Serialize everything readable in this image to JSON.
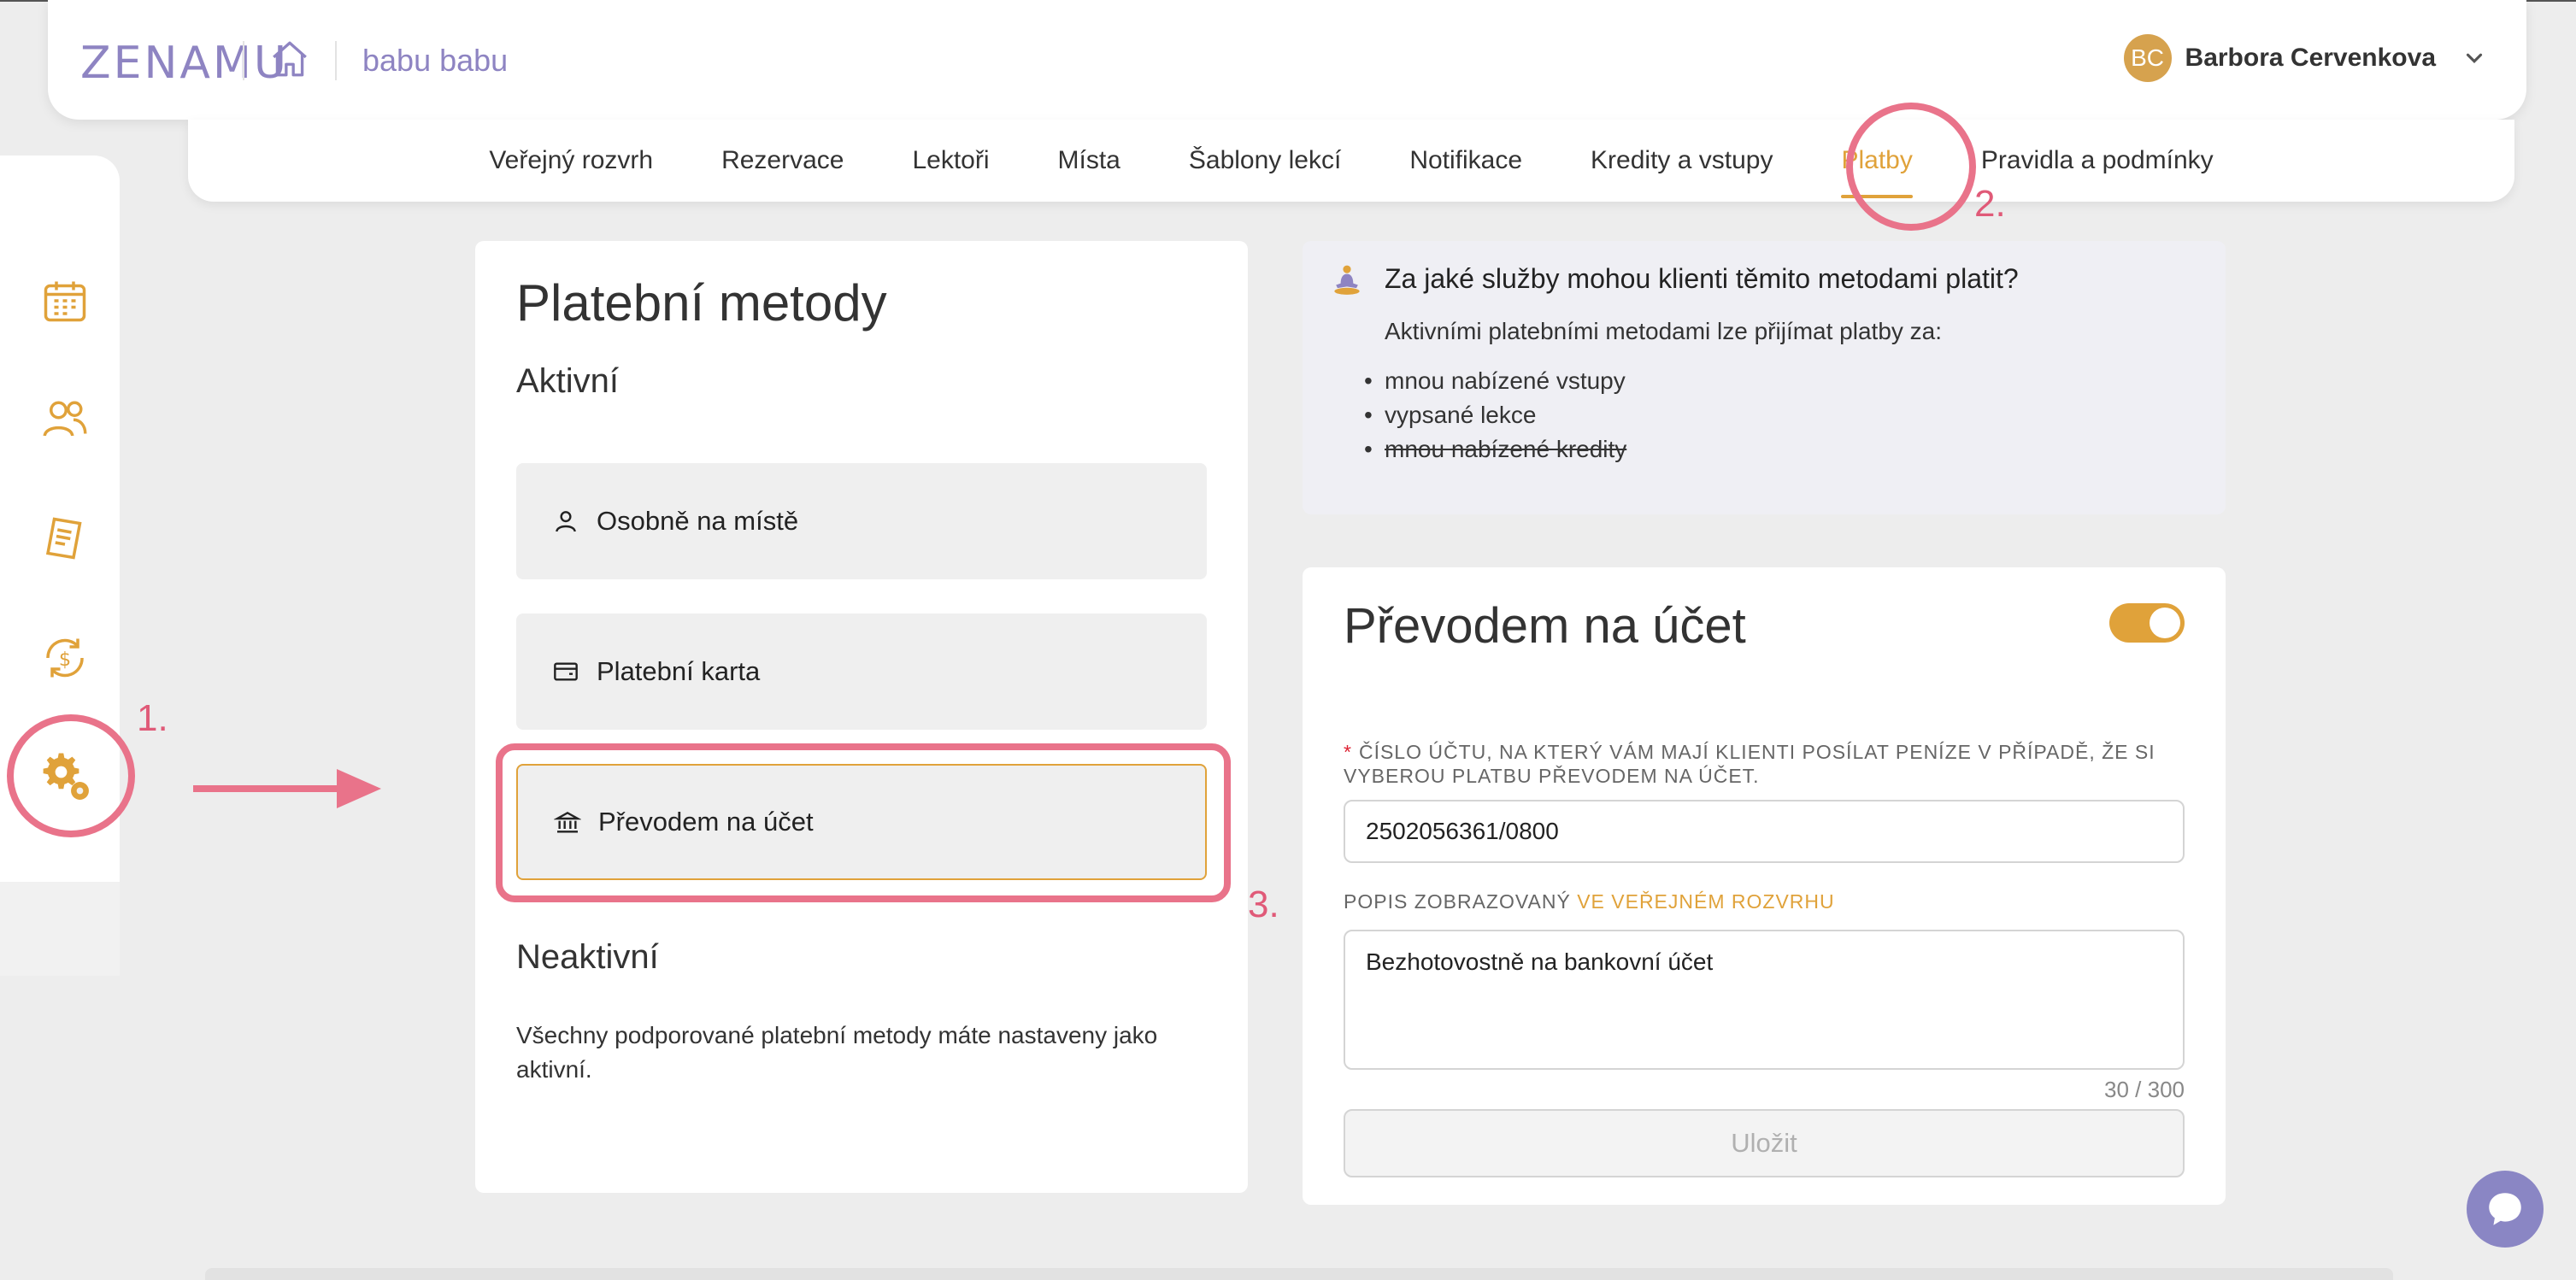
{
  "header": {
    "logo": "ZENAMU",
    "studio_name": "babu babu",
    "user_initials": "BC",
    "user_name": "Barbora Cervenkova"
  },
  "nav": {
    "tabs": [
      {
        "label": "Veřejný rozvrh"
      },
      {
        "label": "Rezervace"
      },
      {
        "label": "Lektoři"
      },
      {
        "label": "Místa"
      },
      {
        "label": "Šablony lekcí"
      },
      {
        "label": "Notifikace"
      },
      {
        "label": "Kredity a vstupy"
      },
      {
        "label": "Platby",
        "active": true
      },
      {
        "label": "Pravidla a podmínky"
      }
    ]
  },
  "sidebar": {
    "icons": [
      "calendar-icon",
      "people-icon",
      "receipt-icon",
      "payments-icon",
      "settings-icon"
    ]
  },
  "payment_methods": {
    "title": "Platební metody",
    "active_heading": "Aktivní",
    "active": [
      {
        "label": "Osobně na místě",
        "icon": "person-icon"
      },
      {
        "label": "Platební karta",
        "icon": "card-icon"
      },
      {
        "label": "Převodem na účet",
        "icon": "bank-icon",
        "selected": true
      }
    ],
    "inactive_heading": "Neaktivní",
    "inactive_note": "Všechny podporované platební metody máte nastaveny jako aktivní."
  },
  "info": {
    "title": "Za jaké služby mohou klienti těmito metodami platit?",
    "subtitle": "Aktivními platebními metodami lze přijímat platby za:",
    "items": [
      {
        "text": "mnou nabízené vstupy",
        "struck": false
      },
      {
        "text": "vypsané lekce",
        "struck": false
      },
      {
        "text": "mnou nabízené kredity",
        "struck": true
      }
    ]
  },
  "transfer_form": {
    "title": "Převodem na účet",
    "enabled": true,
    "account_label": "ČÍSLO ÚČTU, NA KTERÝ VÁM MAJÍ KLIENTI POSÍLAT PENÍZE V PŘÍPADĚ, ŽE SI VYBEROU PLATBU PŘEVODEM NA ÚČET.",
    "account_value": "2502056361/0800",
    "desc_label_prefix": "POPIS ZOBRAZOVANÝ",
    "desc_label_link": "VE VEŘEJNÉM ROZVRHU",
    "desc_value": "Bezhotovostně na bankovní účet",
    "counter": "30 / 300",
    "save_label": "Uložit"
  },
  "annotations": {
    "step1": "1.",
    "step2": "2.",
    "step3": "3."
  },
  "colors": {
    "accent": "#e0a23a",
    "brand": "#8e84c2",
    "annotation": "#e9738a"
  }
}
